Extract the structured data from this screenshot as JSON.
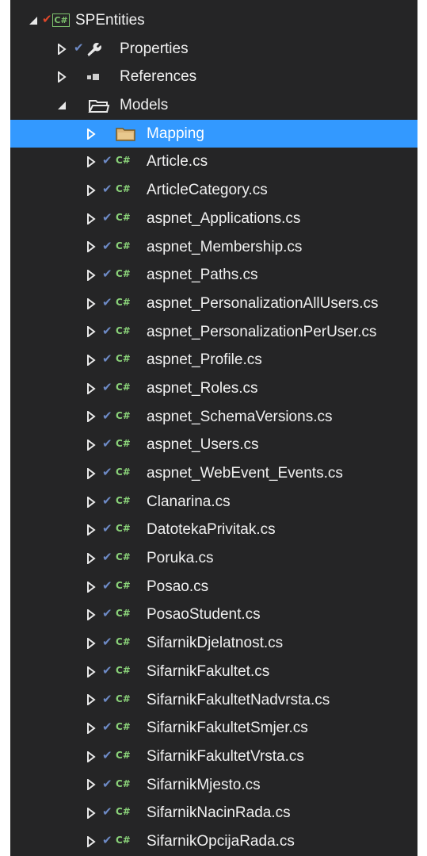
{
  "project": {
    "name": "SPEntities",
    "icon": "csharp-project-icon",
    "badge": "C#",
    "expanded": true
  },
  "nodes": {
    "properties": {
      "label": "Properties",
      "icon": "wrench-icon"
    },
    "references": {
      "label": "References",
      "icon": "references-icon"
    },
    "models": {
      "label": "Models",
      "icon": "folder-open-icon",
      "expanded": true
    },
    "mapping": {
      "label": "Mapping",
      "icon": "folder-icon",
      "selected": true
    }
  },
  "files": [
    "Article.cs",
    "ArticleCategory.cs",
    "aspnet_Applications.cs",
    "aspnet_Membership.cs",
    "aspnet_Paths.cs",
    "aspnet_PersonalizationAllUsers.cs",
    "aspnet_PersonalizationPerUser.cs",
    "aspnet_Profile.cs",
    "aspnet_Roles.cs",
    "aspnet_SchemaVersions.cs",
    "aspnet_Users.cs",
    "aspnet_WebEvent_Events.cs",
    "Clanarina.cs",
    "DatotekaPrivitak.cs",
    "Poruka.cs",
    "Posao.cs",
    "PosaoStudent.cs",
    "SifarnikDjelatnost.cs",
    "SifarnikFakultet.cs",
    "SifarnikFakultetNadvrsta.cs",
    "SifarnikFakultetSmjer.cs",
    "SifarnikFakultetVrsta.cs",
    "SifarnikMjesto.cs",
    "SifarnikNacinRada.cs",
    "SifarnikOpcijaRada.cs"
  ],
  "file_badge": "C#",
  "colors": {
    "background": "#252526",
    "selection": "#3399ff",
    "text": "#f1f1f1",
    "csharp_green": "#8bd37a",
    "check_blue": "#6d8ac5",
    "check_red": "#e0472a",
    "folder": "#dcb67a"
  }
}
